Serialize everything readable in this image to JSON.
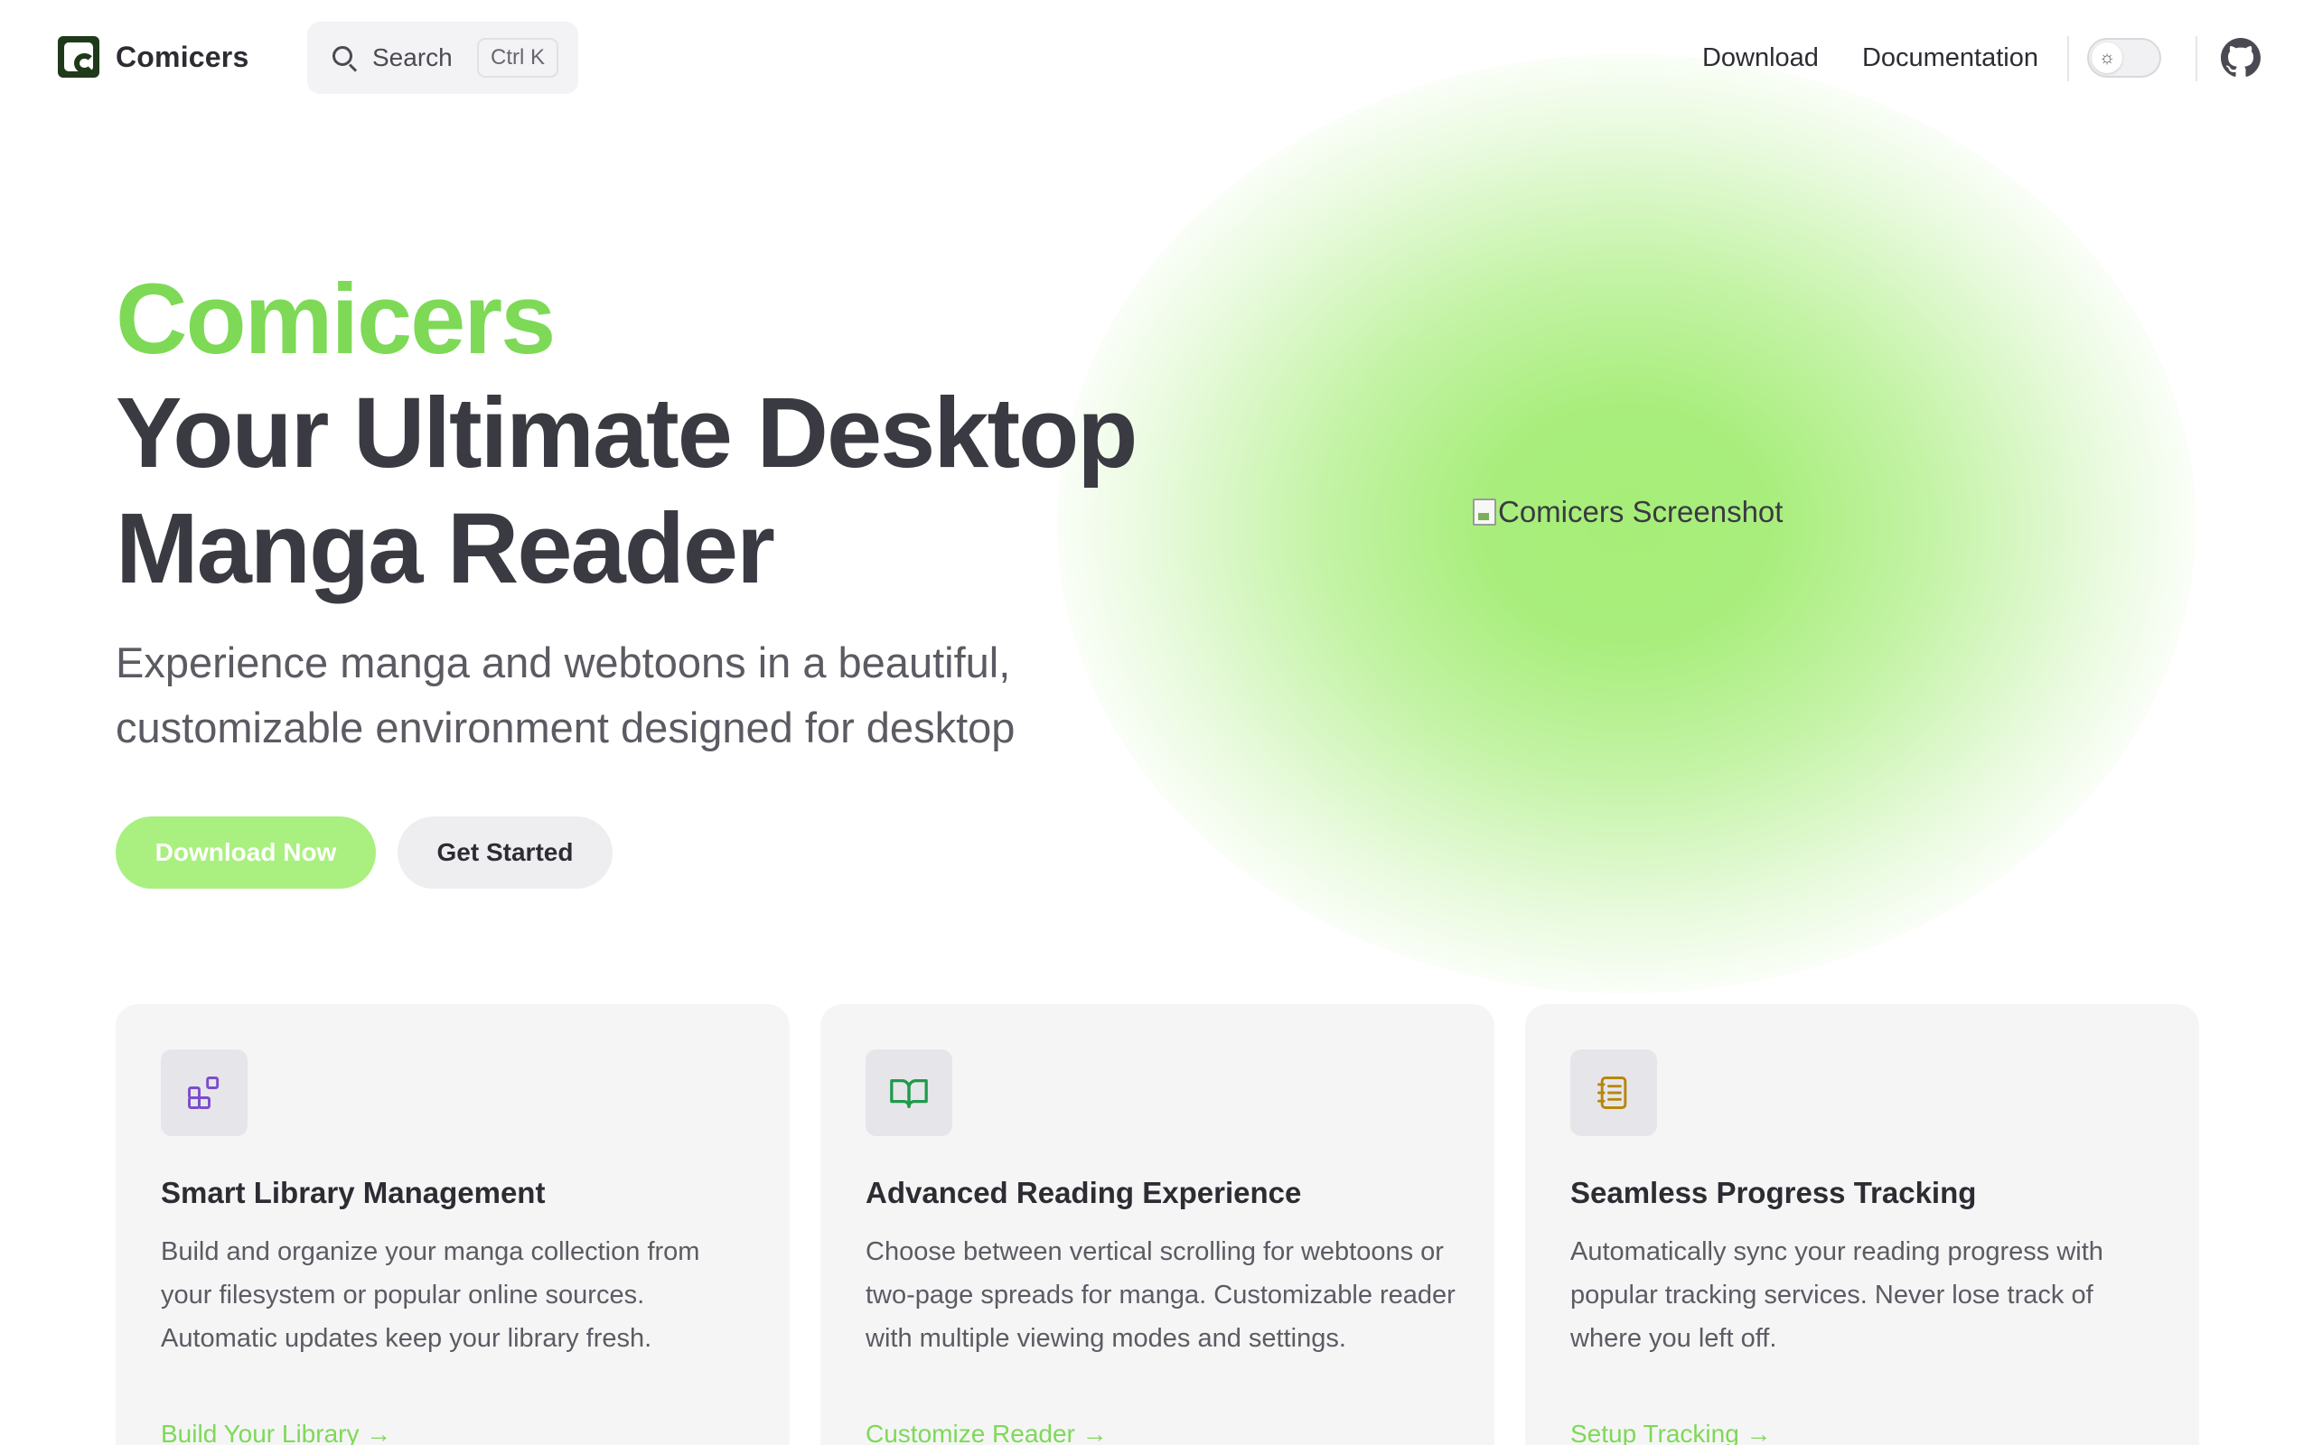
{
  "nav": {
    "brand": "Comicers",
    "search_label": "Search",
    "search_shortcut": "Ctrl K",
    "links": [
      "Download",
      "Documentation"
    ],
    "theme_icon": "sun-icon",
    "github_icon": "github-icon"
  },
  "hero": {
    "name": "Comicers",
    "title": "Your Ultimate Desktop Manga Reader",
    "subtitle": "Experience manga and webtoons in a beautiful, customizable environment designed for desktop",
    "primary_button": "Download Now",
    "secondary_button": "Get Started",
    "screenshot_alt": "Comicers Screenshot"
  },
  "features": [
    {
      "icon": "library-blocks-icon",
      "title": "Smart Library Management",
      "description": "Build and organize your manga collection from your filesystem or popular online sources. Automatic updates keep your library fresh.",
      "link": "Build Your Library →"
    },
    {
      "icon": "open-book-icon",
      "title": "Advanced Reading Experience",
      "description": "Choose between vertical scrolling for webtoons or two-page spreads for manga. Customizable reader with multiple viewing modes and settings.",
      "link": "Customize Reader →"
    },
    {
      "icon": "notebook-icon",
      "title": "Seamless Progress Tracking",
      "description": "Automatically sync your reading progress with popular tracking services. Never lose track of where you left off.",
      "link": "Setup Tracking →"
    }
  ],
  "colors": {
    "accent": "#7ed957",
    "primary_button": "#aaf080",
    "heading": "#3a3a42",
    "card_bg": "#f5f5f6"
  }
}
